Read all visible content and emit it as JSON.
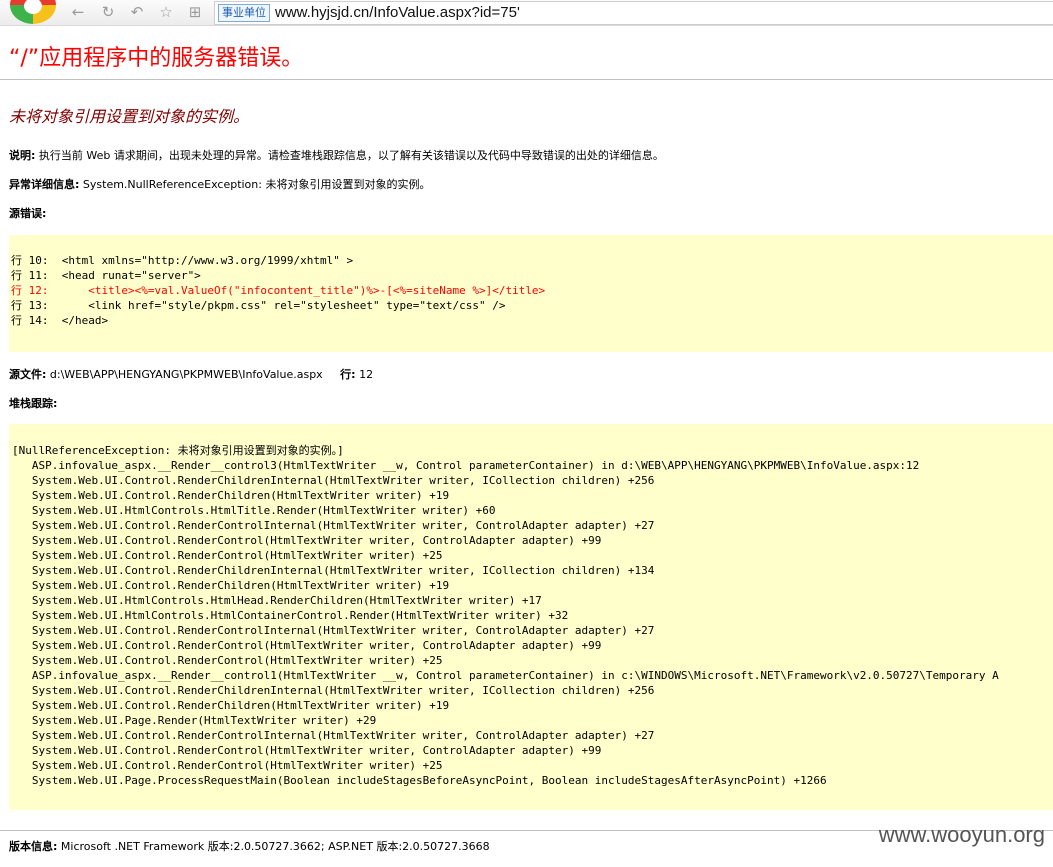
{
  "browser": {
    "badge": "事业单位",
    "url": "www.hyjsjd.cn/InfoValue.aspx?id=75'",
    "icons": [
      "back-icon",
      "refresh-icon",
      "undo-icon",
      "favorite-star-icon",
      "grid-icon"
    ]
  },
  "error": {
    "title": "“/”应用程序中的服务器错误。",
    "message": "未将对象引用设置到对象的实例。",
    "description_label": "说明:",
    "description_text": " 执行当前 Web 请求期间，出现未处理的异常。请检查堆栈跟踪信息，以了解有关该错误以及代码中导致错误的出处的详细信息。",
    "exception_label": "异常详细信息:",
    "exception_text": " System.NullReferenceException: 未将对象引用设置到对象的实例。",
    "source_error_label": "源错误:",
    "source_lines": [
      "行 10:  <html xmlns=\"http://www.w3.org/1999/xhtml\" >",
      "行 11:  <head runat=\"server\">",
      "行 12:      <title><%=val.ValueOf(\"infocontent_title\")%>-[<%=siteName %>]</title>",
      "行 13:      <link href=\"style/pkpm.css\" rel=\"stylesheet\" type=\"text/css\" />",
      "行 14:  </head>"
    ],
    "source_file_label": "源文件:",
    "source_file": " d:\\WEB\\APP\\HENGYANG\\PKPMWEB\\InfoValue.aspx",
    "line_label": "行:",
    "line_number": " 12",
    "stack_label": "堆栈跟踪:",
    "stack_lines": [
      "[NullReferenceException: 未将对象引用设置到对象的实例。]",
      "   ASP.infovalue_aspx.__Render__control3(HtmlTextWriter __w, Control parameterContainer) in d:\\WEB\\APP\\HENGYANG\\PKPMWEB\\InfoValue.aspx:12",
      "   System.Web.UI.Control.RenderChildrenInternal(HtmlTextWriter writer, ICollection children) +256",
      "   System.Web.UI.Control.RenderChildren(HtmlTextWriter writer) +19",
      "   System.Web.UI.HtmlControls.HtmlTitle.Render(HtmlTextWriter writer) +60",
      "   System.Web.UI.Control.RenderControlInternal(HtmlTextWriter writer, ControlAdapter adapter) +27",
      "   System.Web.UI.Control.RenderControl(HtmlTextWriter writer, ControlAdapter adapter) +99",
      "   System.Web.UI.Control.RenderControl(HtmlTextWriter writer) +25",
      "   System.Web.UI.Control.RenderChildrenInternal(HtmlTextWriter writer, ICollection children) +134",
      "   System.Web.UI.Control.RenderChildren(HtmlTextWriter writer) +19",
      "   System.Web.UI.HtmlControls.HtmlHead.RenderChildren(HtmlTextWriter writer) +17",
      "   System.Web.UI.HtmlControls.HtmlContainerControl.Render(HtmlTextWriter writer) +32",
      "   System.Web.UI.Control.RenderControlInternal(HtmlTextWriter writer, ControlAdapter adapter) +27",
      "   System.Web.UI.Control.RenderControl(HtmlTextWriter writer, ControlAdapter adapter) +99",
      "   System.Web.UI.Control.RenderControl(HtmlTextWriter writer) +25",
      "   ASP.infovalue_aspx.__Render__control1(HtmlTextWriter __w, Control parameterContainer) in c:\\WINDOWS\\Microsoft.NET\\Framework\\v2.0.50727\\Temporary A",
      "   System.Web.UI.Control.RenderChildrenInternal(HtmlTextWriter writer, ICollection children) +256",
      "   System.Web.UI.Control.RenderChildren(HtmlTextWriter writer) +19",
      "   System.Web.UI.Page.Render(HtmlTextWriter writer) +29",
      "   System.Web.UI.Control.RenderControlInternal(HtmlTextWriter writer, ControlAdapter adapter) +27",
      "   System.Web.UI.Control.RenderControl(HtmlTextWriter writer, ControlAdapter adapter) +99",
      "   System.Web.UI.Control.RenderControl(HtmlTextWriter writer) +25",
      "   System.Web.UI.Page.ProcessRequestMain(Boolean includeStagesBeforeAsyncPoint, Boolean includeStagesAfterAsyncPoint) +1266"
    ],
    "version_label": "版本信息:",
    "version_text": " Microsoft .NET Framework 版本:2.0.50727.3662; ASP.NET 版本:2.0.50727.3668"
  },
  "watermark": "www.wooyun.org",
  "colors": {
    "title": "#ff0000",
    "message": "#800000",
    "code_background": "#ffffcc"
  }
}
